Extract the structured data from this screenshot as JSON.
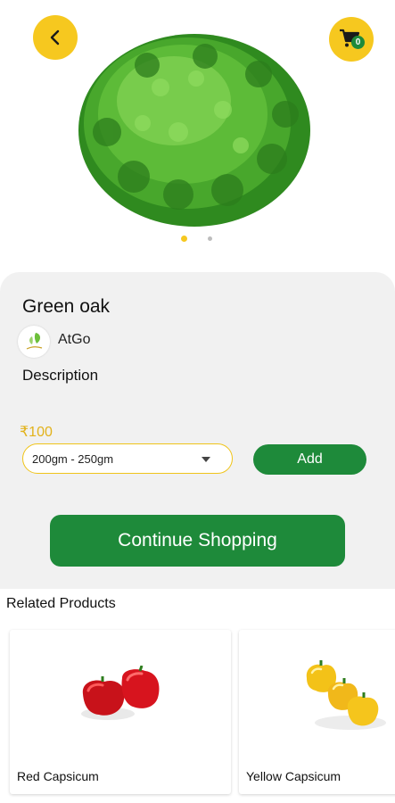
{
  "header": {
    "back_icon": "chevron-left-icon",
    "cart_icon": "cart-icon",
    "cart_count": "0",
    "accent_color": "#f6c81f"
  },
  "product": {
    "name": "Green oak",
    "brand": "AtGo",
    "description_label": "Description",
    "price": "₹100",
    "selected_size": "200gm - 250gm",
    "add_label": "Add",
    "image_count": 2,
    "active_image": 1
  },
  "actions": {
    "continue_label": "Continue Shopping",
    "button_color": "#1e8a3a"
  },
  "related": {
    "title": "Related Products",
    "items": [
      {
        "name": "Red Capsicum"
      },
      {
        "name": "Yellow Capsicum"
      }
    ]
  }
}
